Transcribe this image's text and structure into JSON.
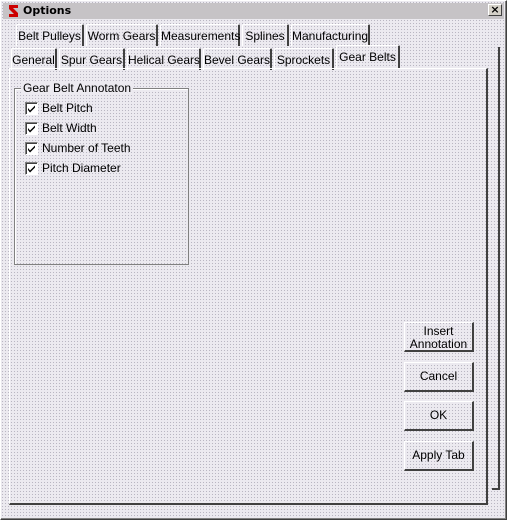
{
  "window": {
    "title": "Options",
    "close_glyph": "×",
    "app_icon": "app-logo-icon"
  },
  "tabs_row1": [
    "Belt Pulleys",
    "Worm Gears",
    "Measurements",
    "Splines",
    "Manufacturing"
  ],
  "tabs_row2": [
    "General",
    "Spur Gears",
    "Helical Gears",
    "Bevel Gears",
    "Sprockets",
    "Gear Belts"
  ],
  "active_tab": "Gear Belts",
  "group": {
    "title": "Gear Belt Annotaton",
    "items": [
      {
        "label": "Belt Pitch",
        "checked": true
      },
      {
        "label": "Belt Width",
        "checked": true
      },
      {
        "label": "Number of Teeth",
        "checked": true
      },
      {
        "label": "Pitch Diameter",
        "checked": true
      }
    ]
  },
  "buttons": {
    "insert_line1": "Insert",
    "insert_line2": "Annotation",
    "cancel": "Cancel",
    "ok": "OK",
    "apply_tab": "Apply Tab"
  },
  "colors": {
    "accent_icon": "#cc0000",
    "face": "#eceaf0"
  }
}
